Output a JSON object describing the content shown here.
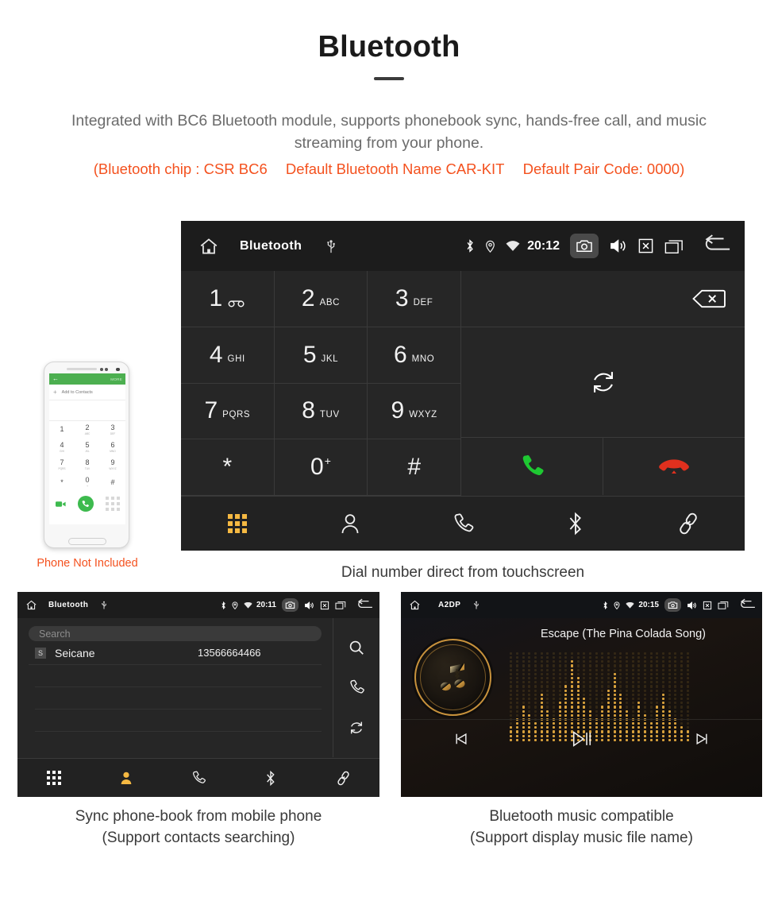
{
  "header": {
    "title": "Bluetooth",
    "description": "Integrated with BC6 Bluetooth module, supports phonebook sync, hands-free call, and music streaming from your phone.",
    "spec_open": "(Bluetooth chip : CSR BC6",
    "spec_name": "Default Bluetooth Name CAR-KIT",
    "spec_pair": "Default Pair Code: 0000)"
  },
  "colors": {
    "accent_orange": "#f4511e",
    "active_amber": "#f5b942",
    "call_green": "#1ec832",
    "end_red": "#e0301e",
    "gold": "#c8923c",
    "panel_bg": "#262626",
    "bar_bg": "#1c1c1c"
  },
  "dialer": {
    "statusbar": {
      "home_icon": "home-icon",
      "title": "Bluetooth",
      "usb_icon": "usb-icon",
      "bluetooth_icon": "bluetooth-icon",
      "location_icon": "location-icon",
      "wifi_icon": "wifi-icon",
      "clock": "20:12",
      "camera_icon": "camera-icon",
      "volume_icon": "volume-icon",
      "close_icon": "close-box-icon",
      "recents_icon": "recents-icon",
      "back_icon": "back-icon"
    },
    "keys": [
      {
        "num": "1",
        "sub": "",
        "icon": "voicemail-icon"
      },
      {
        "num": "2",
        "sub": "ABC",
        "icon": ""
      },
      {
        "num": "3",
        "sub": "DEF",
        "icon": ""
      },
      {
        "num": "4",
        "sub": "GHI",
        "icon": ""
      },
      {
        "num": "5",
        "sub": "JKL",
        "icon": ""
      },
      {
        "num": "6",
        "sub": "MNO",
        "icon": ""
      },
      {
        "num": "7",
        "sub": "PQRS",
        "icon": ""
      },
      {
        "num": "8",
        "sub": "TUV",
        "icon": ""
      },
      {
        "num": "9",
        "sub": "WXYZ",
        "icon": ""
      },
      {
        "num": "*",
        "sub": "",
        "icon": ""
      },
      {
        "num": "0",
        "sup": "+",
        "sub": "",
        "icon": ""
      },
      {
        "num": "#",
        "sub": "",
        "icon": ""
      }
    ],
    "input_value": "",
    "backspace_icon": "backspace-icon",
    "sync_icon": "sync-icon",
    "call_icon": "call-icon",
    "hangup_icon": "hangup-icon",
    "nav": [
      {
        "name": "dialpad",
        "icon": "dialpad-icon",
        "active": true
      },
      {
        "name": "contacts",
        "icon": "contact-icon",
        "active": false
      },
      {
        "name": "calls",
        "icon": "phone-icon",
        "active": false
      },
      {
        "name": "bluetooth",
        "icon": "bluetooth-icon",
        "active": false
      },
      {
        "name": "link",
        "icon": "link-icon",
        "active": false
      }
    ],
    "caption": "Dial number direct from touchscreen"
  },
  "phone_mockup": {
    "back_icon": "back-arrow-icon",
    "more_label": "MORE",
    "add_contact_label": "Add to Contacts",
    "keys": [
      {
        "n": "1",
        "l": ""
      },
      {
        "n": "2",
        "l": "ABC"
      },
      {
        "n": "3",
        "l": "DEF"
      },
      {
        "n": "4",
        "l": "GHI"
      },
      {
        "n": "5",
        "l": "JKL"
      },
      {
        "n": "6",
        "l": "MNO"
      },
      {
        "n": "7",
        "l": "PQRS"
      },
      {
        "n": "8",
        "l": "TUV"
      },
      {
        "n": "9",
        "l": "WXYZ"
      },
      {
        "n": "*",
        "l": ""
      },
      {
        "n": "0",
        "l": "+"
      },
      {
        "n": "#",
        "l": ""
      }
    ],
    "video_icon": "video-call-icon",
    "call_icon": "call-icon",
    "keypad_icon": "keypad-icon",
    "caption": "Phone Not Included"
  },
  "phonebook": {
    "statusbar": {
      "home_icon": "home-icon",
      "title": "Bluetooth",
      "usb_icon": "usb-icon",
      "clock": "20:11",
      "camera_icon": "camera-icon",
      "volume_icon": "volume-icon",
      "close_icon": "close-box-icon",
      "recents_icon": "recents-icon",
      "back_icon": "back-icon"
    },
    "search_placeholder": "Search",
    "search_value": "",
    "contacts": [
      {
        "initial": "S",
        "name": "Seicane",
        "number": "13566664466"
      }
    ],
    "rail": [
      {
        "name": "search",
        "icon": "search-icon"
      },
      {
        "name": "dial",
        "icon": "phone-icon"
      },
      {
        "name": "sync",
        "icon": "sync-icon"
      }
    ],
    "nav": [
      {
        "name": "dialpad",
        "icon": "dialpad-icon",
        "active": false
      },
      {
        "name": "contacts",
        "icon": "contact-icon",
        "active": true
      },
      {
        "name": "calls",
        "icon": "phone-icon",
        "active": false
      },
      {
        "name": "bluetooth",
        "icon": "bluetooth-icon",
        "active": false
      },
      {
        "name": "link",
        "icon": "link-icon",
        "active": false
      }
    ],
    "caption_line1": "Sync phone-book from mobile phone",
    "caption_line2": "(Support contacts searching)"
  },
  "music": {
    "statusbar": {
      "home_icon": "home-icon",
      "title": "A2DP",
      "usb_icon": "usb-icon",
      "clock": "20:15",
      "camera_icon": "camera-icon",
      "volume_icon": "volume-icon",
      "close_icon": "close-box-icon",
      "recents_icon": "recents-icon",
      "back_icon": "back-icon"
    },
    "track_title": "Escape (The Pina Colada Song)",
    "album_art_icon": "music-note-bluetooth-icon",
    "controls": [
      {
        "name": "previous",
        "icon": "previous-icon"
      },
      {
        "name": "play-pause",
        "icon": "play-pause-icon"
      },
      {
        "name": "next",
        "icon": "next-icon"
      }
    ],
    "equalizer_levels": [
      4,
      6,
      9,
      7,
      5,
      12,
      8,
      6,
      10,
      14,
      20,
      16,
      11,
      8,
      6,
      9,
      13,
      17,
      12,
      8,
      6,
      10,
      7,
      5,
      9,
      12,
      8,
      6,
      4,
      3
    ],
    "caption_line1": "Bluetooth music compatible",
    "caption_line2": "(Support display music file name)"
  }
}
